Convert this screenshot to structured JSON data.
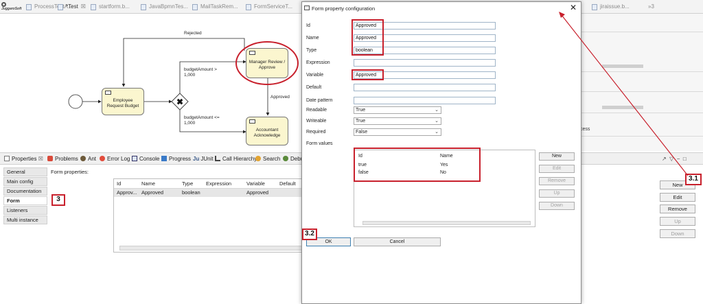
{
  "editor_tabs": [
    {
      "label": "ProcessTestA..."
    },
    {
      "label": "*Test"
    },
    {
      "label": "startform.b..."
    },
    {
      "label": "JavaBpmnTes..."
    },
    {
      "label": "MailTaskRem..."
    },
    {
      "label": "FormServiceT..."
    },
    {
      "label": "jiraissue.b..."
    },
    {
      "label": "»3"
    }
  ],
  "diagram": {
    "tasks": {
      "employee": "Employee Request Budget",
      "manager": "Manager Review / Approve",
      "accountant": "Accountant Acknowledge"
    },
    "labels": {
      "rejected": "Rejected",
      "approved": "Approved",
      "gt": "budgetAmount > 1,000",
      "le": "budgetAmount <= 1,000"
    }
  },
  "outline_fragments": [
    "cess"
  ],
  "view_tabs": [
    "Properties",
    "Problems",
    "Ant",
    "Error Log",
    "Console",
    "Progress",
    "JUnit",
    "Call Hierarchy",
    "Search",
    "Debu"
  ],
  "properties": {
    "side_items": [
      "General",
      "Main config",
      "Documentation",
      "Form",
      "Listeners",
      "Multi instance"
    ],
    "selected": "Form",
    "section_title": "Form properties:",
    "columns": [
      "Id",
      "Name",
      "Type",
      "Expression",
      "Variable",
      "Default"
    ],
    "rows": [
      {
        "id": "Approv...",
        "name": "Approved",
        "type": "boolean",
        "expression": "",
        "variable": "Approved",
        "default": ""
      }
    ],
    "buttons": [
      "New",
      "Edit",
      "Remove",
      "Up",
      "Down"
    ]
  },
  "dialog": {
    "title": "Form property configuration",
    "close": "✕",
    "fields": {
      "id": {
        "label": "Id",
        "value": "Approved"
      },
      "name": {
        "label": "Name",
        "value": "Approved"
      },
      "type": {
        "label": "Type",
        "value": "boolean"
      },
      "expression": {
        "label": "Expression",
        "value": ""
      },
      "variable": {
        "label": "Variable",
        "value": "Approved"
      },
      "default": {
        "label": "Default",
        "value": ""
      },
      "date_pattern": {
        "label": "Date pattern",
        "value": ""
      }
    },
    "selects": {
      "readable": {
        "label": "Readable",
        "value": "True"
      },
      "writeable": {
        "label": "Writeable",
        "value": "True"
      },
      "required": {
        "label": "Required",
        "value": "False"
      }
    },
    "form_values": {
      "label": "Form values",
      "columns": [
        "Id",
        "Name"
      ],
      "rows": [
        {
          "id": "true",
          "name": "Yes"
        },
        {
          "id": "false",
          "name": "No"
        }
      ],
      "buttons": [
        "New",
        "Edit",
        "Remove",
        "Up",
        "Down"
      ]
    },
    "ok": "OK",
    "cancel": "Cancel"
  },
  "annotations": {
    "n3": "3",
    "n31": "3.1",
    "n32": "3.2"
  },
  "colors": {
    "annotation": "#c8202c",
    "task_fill": "#fbf6cf"
  }
}
